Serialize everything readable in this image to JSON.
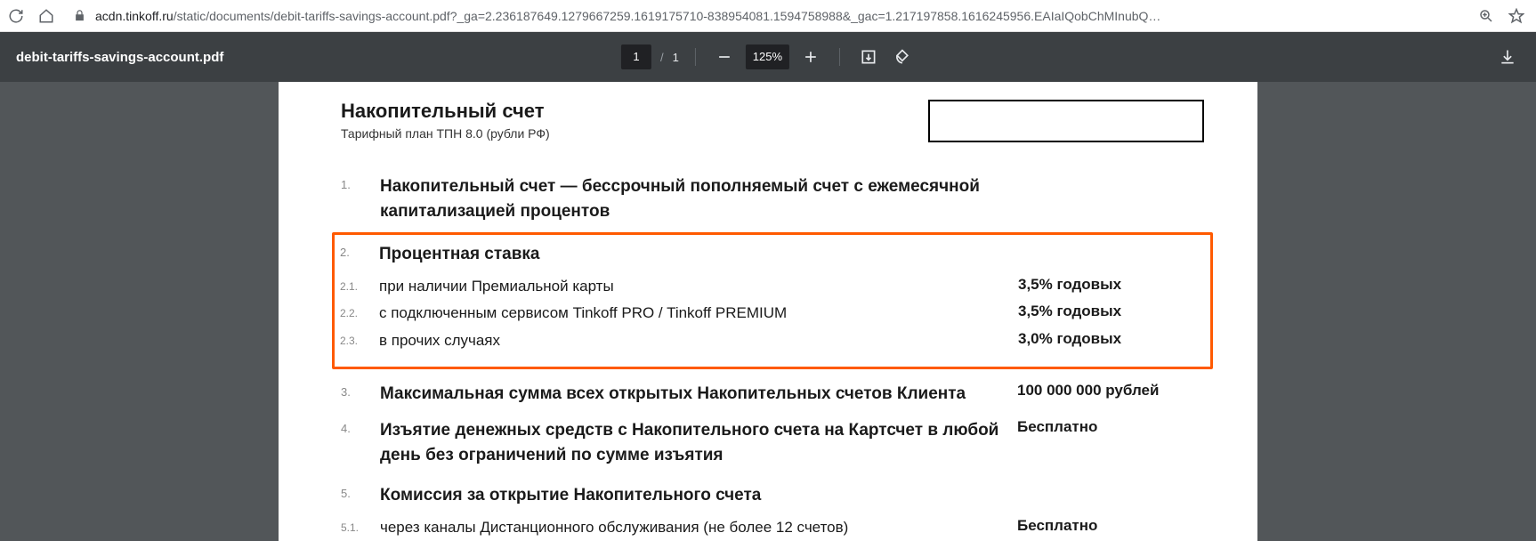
{
  "browser": {
    "url_domain": "acdn.tinkoff.ru",
    "url_path": "/static/documents/debit-tariffs-savings-account.pdf?_ga=2.236187649.1279667259.1619175710-838954081.1594758988&_gac=1.217197858.1616245956.EAIaIQobChMInubQ…"
  },
  "pdf": {
    "filename": "debit-tariffs-savings-account.pdf",
    "page_current": "1",
    "page_total": "1",
    "zoom_label": "125%"
  },
  "doc": {
    "title": "Накопительный счет",
    "subtitle": "Тарифный план ТПН 8.0 (рубли РФ)",
    "row1_num": "1.",
    "row1_text": "Накопительный счет — бессрочный пополняемый счет с ежемесячной капитализацией процентов",
    "row2_num": "2.",
    "row2_text": "Процентная ставка",
    "row21_num": "2.1.",
    "row21_text": "при наличии Премиальной карты",
    "row21_val": "3,5% годовых",
    "row22_num": "2.2.",
    "row22_text": "с подключенным сервисом Tinkoff PRO / Tinkoff PREMIUM",
    "row22_val": "3,5% годовых",
    "row23_num": "2.3.",
    "row23_text": "в прочих случаях",
    "row23_val": "3,0% годовых",
    "row3_num": "3.",
    "row3_text": "Максимальная сумма всех открытых Накопительных счетов Клиента",
    "row3_val": "100 000 000 рублей",
    "row4_num": "4.",
    "row4_text": "Изъятие денежных средств с Накопительного счета на Картсчет в любой день без ограничений по сумме изъятия",
    "row4_val": "Бесплатно",
    "row5_num": "5.",
    "row5_text": "Комиссия за открытие Накопительного счета",
    "row51_num": "5.1.",
    "row51_text": "через каналы Дистанционного обслуживания (не более 12 счетов)",
    "row51_val": "Бесплатно"
  }
}
